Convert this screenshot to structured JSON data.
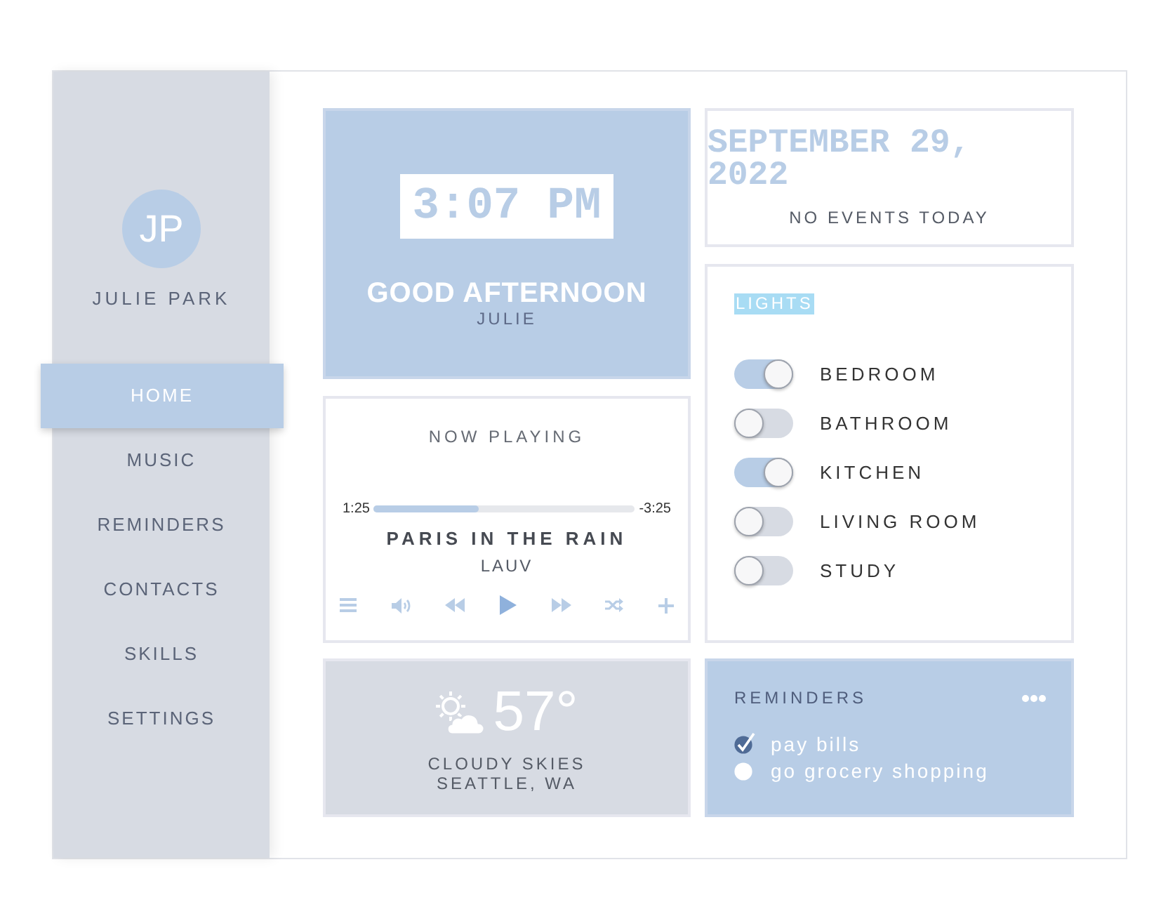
{
  "sidebar": {
    "avatar_initials": "JP",
    "user_name": "JULIE PARK",
    "nav_items": [
      {
        "label": "HOME",
        "selected": true
      },
      {
        "label": "MUSIC",
        "selected": false
      },
      {
        "label": "REMINDERS",
        "selected": false
      },
      {
        "label": "CONTACTS",
        "selected": false
      },
      {
        "label": "SKILLS",
        "selected": false
      },
      {
        "label": "SETTINGS",
        "selected": false
      }
    ]
  },
  "clock": {
    "time": "3:07 PM",
    "greeting": "GOOD AFTERNOON",
    "name": "JULIE"
  },
  "calendar": {
    "date": "SEPTEMBER 29, 2022",
    "events": "NO EVENTS TODAY"
  },
  "lights": {
    "title": "LIGHTS",
    "rooms": [
      {
        "label": "BEDROOM",
        "on": true
      },
      {
        "label": "BATHROOM",
        "on": false
      },
      {
        "label": "KITCHEN",
        "on": true
      },
      {
        "label": "LIVING ROOM",
        "on": false
      },
      {
        "label": "STUDY",
        "on": false
      }
    ]
  },
  "now_playing": {
    "title": "NOW PLAYING",
    "elapsed": "1:25",
    "remaining": "-3:25",
    "level": 0.4,
    "song": "PARIS IN THE RAIN",
    "artist": "LAUV"
  },
  "weather": {
    "temperature": "57°",
    "condition": "CLOUDY SKIES",
    "location": "SEATTLE, WA"
  },
  "reminders": {
    "title": "REMINDERS",
    "items": [
      {
        "text": "pay bills",
        "checked": true
      },
      {
        "text": "go grocery shopping",
        "checked": false
      }
    ]
  }
}
